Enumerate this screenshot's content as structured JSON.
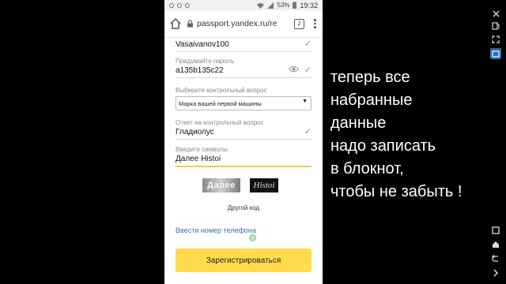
{
  "statusbar": {
    "battery": "53%",
    "time": "19:32"
  },
  "browser": {
    "url": "passport.yandex.ru/re",
    "tab_count": "2"
  },
  "form": {
    "login_value": "Vasaivanov100",
    "password_label": "Придумайте пароль",
    "password_value": "a135b135c22",
    "question_label": "Выберите контрольный вопрос",
    "question_value": "Марка вашей первой машины",
    "answer_label": "Ответ на контрольный вопрос",
    "answer_value": "Гладиолус",
    "captcha_label": "Введите символы",
    "captcha_value": "Далее Histoi",
    "captcha_word1": "Далее",
    "captcha_word2": "Histoi",
    "other_code": "Другой код",
    "phone_link": "Ввести номер телефона",
    "register_button": "Зарегистрироваться"
  },
  "caption": {
    "line1": "теперь все",
    "line2": "набранные",
    "line3": "данные",
    "line4": "надо записать",
    "line5": "в блокнот,",
    "line6": "чтобы не забыть !"
  },
  "colors": {
    "accent_yellow": "#ffdb4d",
    "check_green": "#5cb85c",
    "link_blue": "#3c6fb0"
  }
}
